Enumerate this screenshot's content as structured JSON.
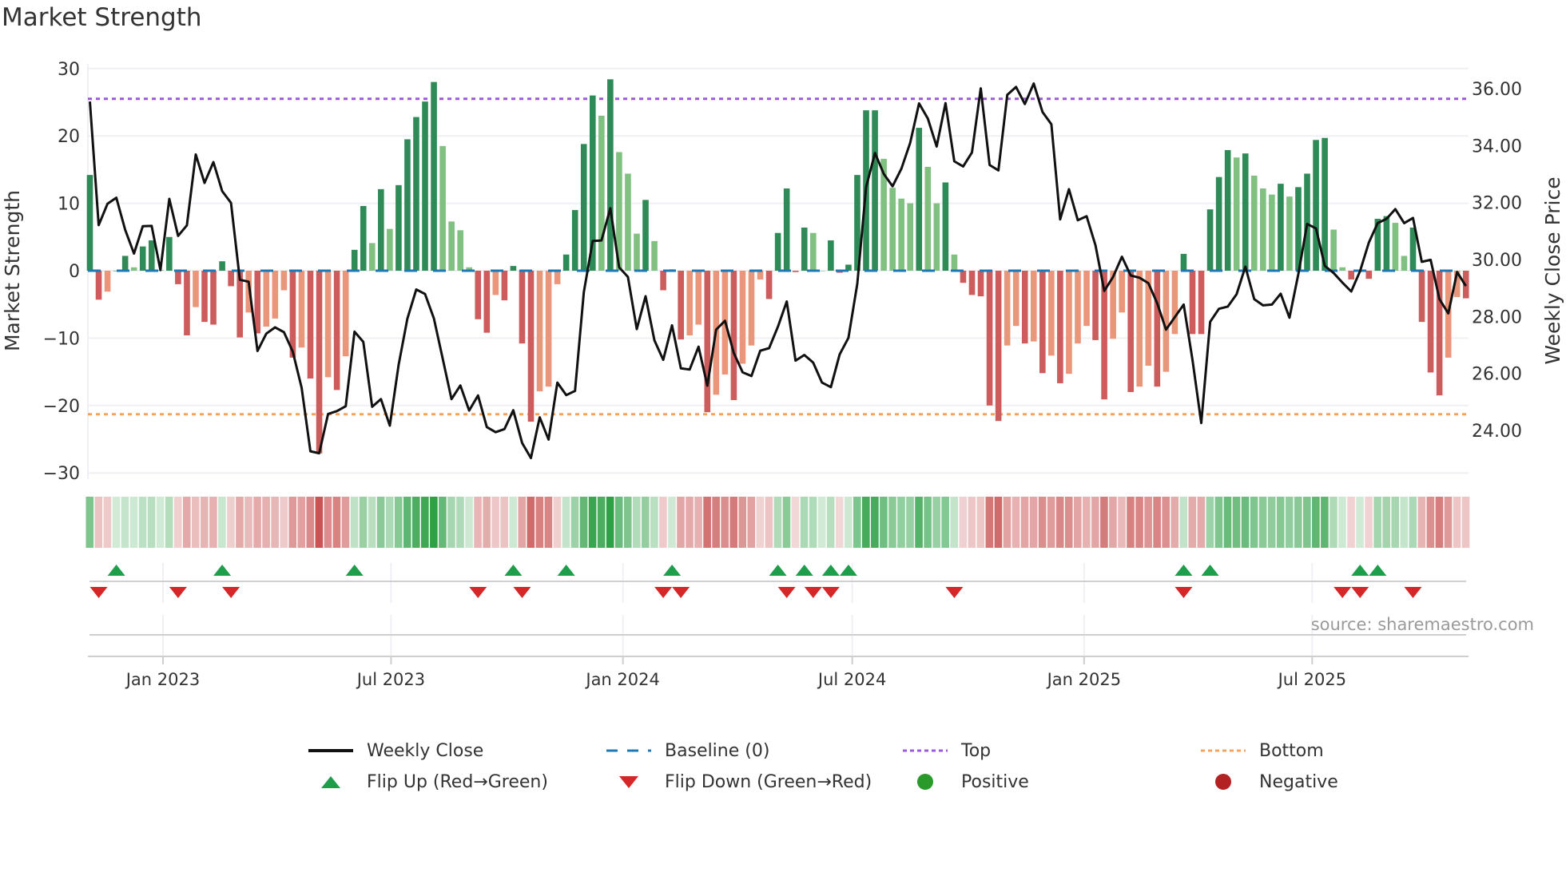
{
  "title": "Market Strength",
  "source": "source: sharemaestro.com",
  "legend": {
    "weekly_close": "Weekly Close",
    "baseline": "Baseline (0)",
    "top": "Top",
    "bottom": "Bottom",
    "flip_up": "Flip Up (Red→Green)",
    "flip_down": "Flip Down (Green→Red)",
    "positive": "Positive",
    "negative": "Negative"
  },
  "colors": {
    "strong_green": "#2e8b57",
    "weak_green": "#80c080",
    "strong_red": "#cd5c5c",
    "weak_red": "#e9967a",
    "baseline": "#1f77b4",
    "top": "#9b59d6",
    "bottom": "#f4a460",
    "flip_up": "#1e9e4a",
    "flip_down": "#d62728",
    "positive": "#2a9a2a",
    "negative": "#b22222",
    "close_line": "#111111"
  },
  "chart_data": {
    "type": "bar",
    "title": "Market Strength",
    "xlabel": "",
    "ylabel": "Market Strength",
    "y2label": "Weekly Close Price",
    "start_date": "2022-11-04",
    "interval": "weekly",
    "ylim": [
      -30,
      30
    ],
    "yticks": [
      30,
      20,
      10,
      0,
      -10,
      -20,
      -30
    ],
    "y2lim": [
      23.0,
      36.8
    ],
    "y2ticks": [
      "36.00",
      "34.00",
      "32.00",
      "30.00",
      "28.00",
      "26.00",
      "24.00"
    ],
    "xticks": [
      {
        "label": "Jan 2023",
        "date": "2023-01-01"
      },
      {
        "label": "Jul 2023",
        "date": "2023-07-01"
      },
      {
        "label": "Jan 2024",
        "date": "2024-01-01"
      },
      {
        "label": "Jul 2024",
        "date": "2024-07-01"
      },
      {
        "label": "Jan 2025",
        "date": "2025-01-01"
      },
      {
        "label": "Jul 2025",
        "date": "2025-07-01"
      }
    ],
    "top_level": 25.5,
    "bottom_level": -21.3,
    "baseline": 0,
    "strength": [
      14.2,
      -4.3,
      -3.1,
      0,
      2.2,
      0.5,
      3.6,
      4.5,
      0.1,
      5.0,
      -2.0,
      -9.6,
      -5.4,
      -7.6,
      -8.0,
      1.4,
      -2.3,
      -9.9,
      -6.2,
      -9.3,
      -8.3,
      -7.1,
      -2.9,
      -12.9,
      -11.4,
      -16.0,
      -27.1,
      -15.8,
      -17.7,
      -12.7,
      3.1,
      9.6,
      4.1,
      12.1,
      6.2,
      12.7,
      19.5,
      22.8,
      25.1,
      28.0,
      18.5,
      7.3,
      6.0,
      0.5,
      -7.2,
      -9.2,
      -3.6,
      -4.4,
      0.7,
      -10.8,
      -22.4,
      -17.9,
      -17.2,
      -2.0,
      2.4,
      9.0,
      18.8,
      26.0,
      23.0,
      28.4,
      17.6,
      14.4,
      5.5,
      10.5,
      4.4,
      -2.9,
      0.2,
      -10.2,
      -9.6,
      -8.0,
      -21.0,
      -18.4,
      -15.4,
      -19.2,
      -13.8,
      -11.1,
      -1.3,
      -4.2,
      5.6,
      12.2,
      -0.2,
      6.4,
      5.6,
      0,
      4.5,
      -0.3,
      0.9,
      14.2,
      23.8,
      23.8,
      16.6,
      12.3,
      10.7,
      10.0,
      21.2,
      15.4,
      10.0,
      13.1,
      2.4,
      -1.8,
      -3.6,
      -3.8,
      -20.0,
      -22.3,
      -11.1,
      -8.2,
      -10.8,
      -10.5,
      -15.2,
      -12.6,
      -16.7,
      -15.3,
      -10.8,
      -8.2,
      -10.3,
      -19.1,
      -10.1,
      -6.2,
      -18.0,
      -17.2,
      -14.1,
      -17.2,
      -15.0,
      -9.4,
      2.5,
      -9.4,
      -9.4,
      9.1,
      13.9,
      17.9,
      16.8,
      17.4,
      14.1,
      12.2,
      11.3,
      12.9,
      11.0,
      12.4,
      14.4,
      19.4,
      19.7,
      6.1,
      0.5,
      -1.3,
      0,
      -1.2,
      7.7,
      8.1,
      7.1,
      2.2,
      6.4,
      -7.6,
      -15.1,
      -18.5,
      -12.9,
      -3.9,
      -4.1
    ],
    "close": [
      35.55,
      31.21,
      31.96,
      32.17,
      31.04,
      30.21,
      31.17,
      31.18,
      29.63,
      32.13,
      30.83,
      31.2,
      33.69,
      32.69,
      33.42,
      32.4,
      31.99,
      29.29,
      29.22,
      26.79,
      27.4,
      27.62,
      27.45,
      26.77,
      25.5,
      23.27,
      23.2,
      24.58,
      24.68,
      24.85,
      27.47,
      27.11,
      24.83,
      25.1,
      24.17,
      26.3,
      27.93,
      28.95,
      28.79,
      27.93,
      26.52,
      25.1,
      25.58,
      24.7,
      25.23,
      24.12,
      23.94,
      24.05,
      24.71,
      23.56,
      23.03,
      24.46,
      23.68,
      25.68,
      25.24,
      25.39,
      28.85,
      30.65,
      30.67,
      31.8,
      29.73,
      29.39,
      27.56,
      28.71,
      27.16,
      26.48,
      27.69,
      26.18,
      26.14,
      26.94,
      25.57,
      27.54,
      27.85,
      26.72,
      26.04,
      25.91,
      26.8,
      26.89,
      27.64,
      28.53,
      26.45,
      26.65,
      26.38,
      25.68,
      25.52,
      26.67,
      27.25,
      29.15,
      32.54,
      33.74,
      33.01,
      32.57,
      33.19,
      34.1,
      35.48,
      34.95,
      33.97,
      35.49,
      33.45,
      33.27,
      33.76,
      36.01,
      33.32,
      33.13,
      35.78,
      36.06,
      35.46,
      36.18,
      35.18,
      34.75,
      31.41,
      32.47,
      31.38,
      31.52,
      30.5,
      28.9,
      29.39,
      30.1,
      29.44,
      29.36,
      29.17,
      28.47,
      27.54,
      27.98,
      28.42,
      26.48,
      24.26,
      27.81,
      28.27,
      28.35,
      28.78,
      29.75,
      28.61,
      28.39,
      28.42,
      28.8,
      27.96,
      29.49,
      31.25,
      31.09,
      29.78,
      29.53,
      29.19,
      28.88,
      29.6,
      30.6,
      31.28,
      31.43,
      31.77,
      31.28,
      31.46,
      29.92,
      29.99,
      28.61,
      28.11,
      29.56,
      29.07
    ],
    "flip_up_weeks": [
      4,
      16,
      31,
      49,
      55,
      67,
      79,
      82,
      85,
      87,
      125,
      128,
      145,
      147
    ],
    "flip_down_weeks": [
      2,
      11,
      17,
      45,
      50,
      66,
      68,
      80,
      83,
      85,
      99,
      125,
      143,
      145,
      151
    ],
    "grid": true,
    "legend_position": "bottom-center"
  }
}
